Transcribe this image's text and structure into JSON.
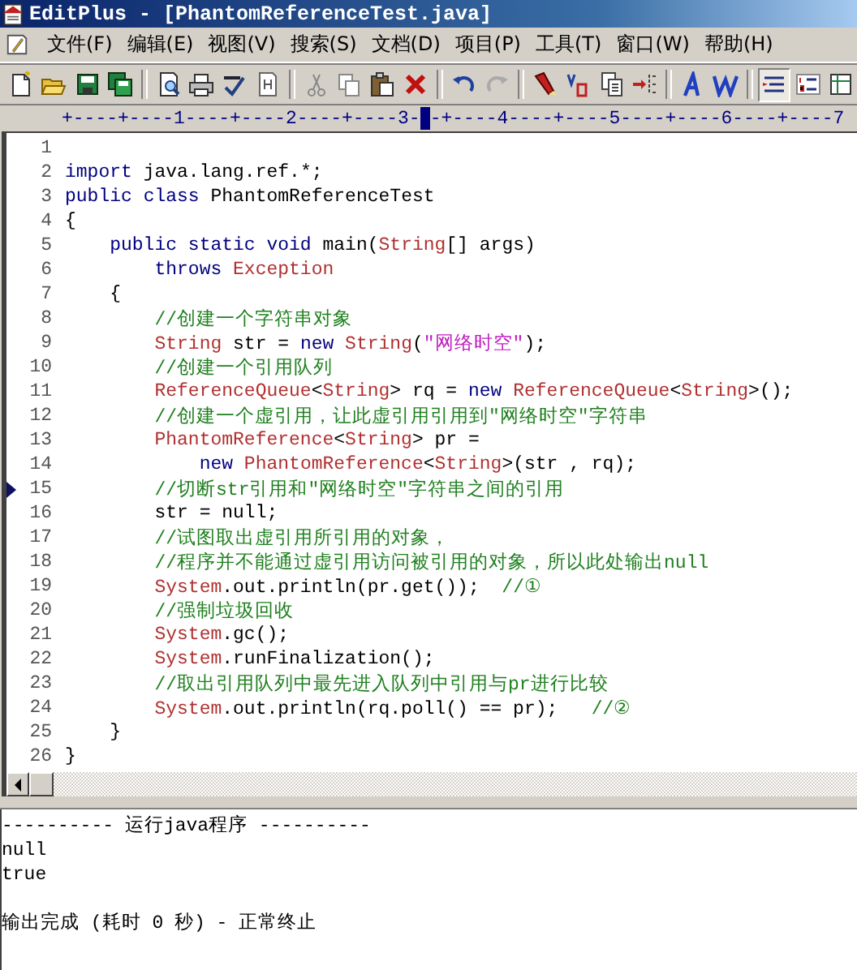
{
  "window": {
    "title": "EditPlus - [PhantomReferenceTest.java]"
  },
  "menu": [
    "文件(F)",
    "编辑(E)",
    "视图(V)",
    "搜索(S)",
    "文档(D)",
    "项目(P)",
    "工具(T)",
    "窗口(W)",
    "帮助(H)"
  ],
  "toolbar": [
    {
      "kind": "new",
      "pressed": false
    },
    {
      "kind": "open",
      "pressed": false
    },
    {
      "kind": "save",
      "pressed": false
    },
    {
      "kind": "save-all",
      "pressed": false
    },
    {
      "kind": "sep"
    },
    {
      "kind": "preview",
      "pressed": false
    },
    {
      "kind": "print",
      "pressed": false
    },
    {
      "kind": "spell",
      "pressed": false
    },
    {
      "kind": "html",
      "pressed": false
    },
    {
      "kind": "sep"
    },
    {
      "kind": "cut",
      "pressed": false
    },
    {
      "kind": "copy",
      "pressed": false
    },
    {
      "kind": "paste",
      "pressed": false
    },
    {
      "kind": "delete",
      "pressed": false
    },
    {
      "kind": "sep"
    },
    {
      "kind": "undo",
      "pressed": false
    },
    {
      "kind": "redo",
      "pressed": false
    },
    {
      "kind": "sep"
    },
    {
      "kind": "find",
      "pressed": false
    },
    {
      "kind": "replace",
      "pressed": false
    },
    {
      "kind": "pages",
      "pressed": false
    },
    {
      "kind": "indent",
      "pressed": false
    },
    {
      "kind": "sep"
    },
    {
      "kind": "font",
      "pressed": false
    },
    {
      "kind": "wrap",
      "pressed": false
    },
    {
      "kind": "sep"
    },
    {
      "kind": "lines",
      "pressed": true
    },
    {
      "kind": "numbers",
      "pressed": false
    },
    {
      "kind": "column",
      "pressed": false
    }
  ],
  "ruler": {
    "before": "+----+----1----+----2----+----3-",
    "after": "-+----4----+----5----+----6----+----7"
  },
  "code": [
    {
      "num": "1",
      "current": false
    },
    {
      "num": "2",
      "current": false,
      "tokens": [
        {
          "kind": "kw",
          "text": "import"
        },
        {
          "kind": "plain",
          "text": " java.lang.ref.*;"
        }
      ]
    },
    {
      "num": "3",
      "current": false,
      "tokens": [
        {
          "kind": "kw",
          "text": "public"
        },
        {
          "kind": "kw",
          "text": " class"
        },
        {
          "kind": "plain",
          "text": " PhantomReferenceTest"
        }
      ]
    },
    {
      "num": "4",
      "current": false,
      "tokens": [
        {
          "kind": "plain",
          "text": "{"
        }
      ]
    },
    {
      "num": "5",
      "current": false,
      "tokens": [
        {
          "kind": "kw",
          "text": "    public"
        },
        {
          "kind": "kw",
          "text": " static"
        },
        {
          "kind": "kw",
          "text": " void"
        },
        {
          "kind": "plain",
          "text": " main("
        },
        {
          "kind": "type",
          "text": "String"
        },
        {
          "kind": "plain",
          "text": "[] args)"
        }
      ]
    },
    {
      "num": "6",
      "current": false,
      "tokens": [
        {
          "kind": "kw",
          "text": "        throws"
        },
        {
          "kind": "type",
          "text": " Exception"
        }
      ]
    },
    {
      "num": "7",
      "current": false,
      "tokens": [
        {
          "kind": "plain",
          "text": "    {"
        }
      ]
    },
    {
      "num": "8",
      "current": false,
      "tokens": [
        {
          "kind": "comment",
          "text": "        //创建一个字符串对象"
        }
      ]
    },
    {
      "num": "9",
      "current": false,
      "tokens": [
        {
          "kind": "type",
          "text": "        String"
        },
        {
          "kind": "plain",
          "text": " str = "
        },
        {
          "kind": "kw",
          "text": "new"
        },
        {
          "kind": "type",
          "text": " String"
        },
        {
          "kind": "plain",
          "text": "("
        },
        {
          "kind": "string",
          "text": "\"网络时空\""
        },
        {
          "kind": "plain",
          "text": ");"
        }
      ]
    },
    {
      "num": "10",
      "current": false,
      "tokens": [
        {
          "kind": "comment",
          "text": "        //创建一个引用队列"
        }
      ]
    },
    {
      "num": "11",
      "current": false,
      "tokens": [
        {
          "kind": "type",
          "text": "        ReferenceQueue"
        },
        {
          "kind": "plain",
          "text": "<"
        },
        {
          "kind": "type",
          "text": "String"
        },
        {
          "kind": "plain",
          "text": "> rq = "
        },
        {
          "kind": "kw",
          "text": "new"
        },
        {
          "kind": "type",
          "text": " ReferenceQueue"
        },
        {
          "kind": "plain",
          "text": "<"
        },
        {
          "kind": "type",
          "text": "String"
        },
        {
          "kind": "plain",
          "text": ">();"
        }
      ]
    },
    {
      "num": "12",
      "current": false,
      "tokens": [
        {
          "kind": "comment",
          "text": "        //创建一个虚引用，让此虚引用引用到\"网络时空\"字符串"
        }
      ]
    },
    {
      "num": "13",
      "current": false,
      "tokens": [
        {
          "kind": "type",
          "text": "        PhantomReference"
        },
        {
          "kind": "plain",
          "text": "<"
        },
        {
          "kind": "type",
          "text": "String"
        },
        {
          "kind": "plain",
          "text": "> pr ="
        }
      ]
    },
    {
      "num": "14",
      "current": false,
      "tokens": [
        {
          "kind": "kw",
          "text": "            new"
        },
        {
          "kind": "type",
          "text": " PhantomReference"
        },
        {
          "kind": "plain",
          "text": "<"
        },
        {
          "kind": "type",
          "text": "String"
        },
        {
          "kind": "plain",
          "text": ">(str , rq);"
        }
      ]
    },
    {
      "num": "15",
      "current": true,
      "tokens": [
        {
          "kind": "comment",
          "text": "        //切断str引用和\"网络时空\"字符串之间的引用"
        }
      ]
    },
    {
      "num": "16",
      "current": false,
      "tokens": [
        {
          "kind": "plain",
          "text": "        str = null;"
        }
      ]
    },
    {
      "num": "17",
      "current": false,
      "tokens": [
        {
          "kind": "comment",
          "text": "        //试图取出虚引用所引用的对象，"
        }
      ]
    },
    {
      "num": "18",
      "current": false,
      "tokens": [
        {
          "kind": "comment",
          "text": "        //程序并不能通过虚引用访问被引用的对象，所以此处输出null"
        }
      ]
    },
    {
      "num": "19",
      "current": false,
      "tokens": [
        {
          "kind": "type",
          "text": "        System"
        },
        {
          "kind": "plain",
          "text": ".out.println(pr.get());"
        },
        {
          "kind": "comment",
          "text": "  //①"
        }
      ]
    },
    {
      "num": "20",
      "current": false,
      "tokens": [
        {
          "kind": "comment",
          "text": "        //强制垃圾回收"
        }
      ]
    },
    {
      "num": "21",
      "current": false,
      "tokens": [
        {
          "kind": "type",
          "text": "        System"
        },
        {
          "kind": "plain",
          "text": ".gc();"
        }
      ]
    },
    {
      "num": "22",
      "current": false,
      "tokens": [
        {
          "kind": "type",
          "text": "        System"
        },
        {
          "kind": "plain",
          "text": ".runFinalization();"
        }
      ]
    },
    {
      "num": "23",
      "current": false,
      "tokens": [
        {
          "kind": "comment",
          "text": "        //取出引用队列中最先进入队列中引用与pr进行比较"
        }
      ]
    },
    {
      "num": "24",
      "current": false,
      "tokens": [
        {
          "kind": "type",
          "text": "        System"
        },
        {
          "kind": "plain",
          "text": ".out.println(rq.poll() == pr);"
        },
        {
          "kind": "comment",
          "text": "   //②"
        }
      ]
    },
    {
      "num": "25",
      "current": false,
      "tokens": [
        {
          "kind": "plain",
          "text": "    }"
        }
      ]
    },
    {
      "num": "26",
      "current": false,
      "tokens": [
        {
          "kind": "plain",
          "text": "}"
        }
      ]
    }
  ],
  "output": [
    {
      "lines": [
        "---------- 运行java程序 ----------",
        "null",
        "true"
      ]
    },
    {
      "lines": [
        "输出完成 (耗时 0 秒) - 正常终止"
      ]
    }
  ]
}
